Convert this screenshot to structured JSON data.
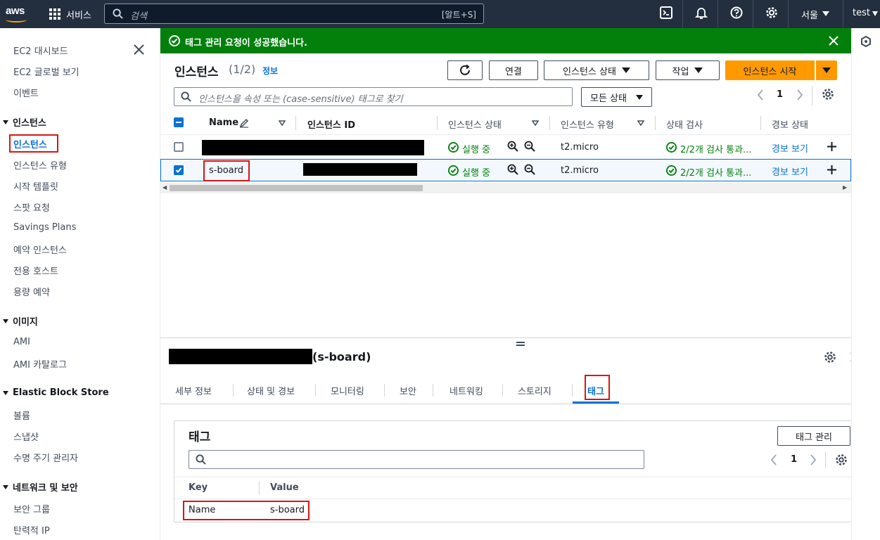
{
  "topbar": {
    "logo_text": "aws",
    "services_label": "서비스",
    "search_placeholder": "검색",
    "search_shortcut": "[알트+S]",
    "region": "서울",
    "user": "test"
  },
  "sidebar": {
    "items": [
      {
        "label": "EC2 대시보드"
      },
      {
        "label": "EC2 글로벌 보기"
      },
      {
        "label": "이벤트"
      }
    ],
    "sections": [
      {
        "title": "인스턴스",
        "items": [
          "인스턴스",
          "인스턴스 유형",
          "시작 템플릿",
          "스팟 요청",
          "Savings Plans",
          "예약 인스턴스",
          "전용 호스트",
          "용량 예약"
        ]
      },
      {
        "title": "이미지",
        "items": [
          "AMI",
          "AMI 카탈로그"
        ]
      },
      {
        "title": "Elastic Block Store",
        "items": [
          "볼륨",
          "스냅샷",
          "수명 주기 관리자"
        ]
      },
      {
        "title": "네트워크 및 보안",
        "items": [
          "보안 그룹",
          "탄력적 IP"
        ]
      }
    ]
  },
  "flash": {
    "message": "태그 관리 요청이 성공했습니다."
  },
  "instances": {
    "title": "인스턴스",
    "count": "(1/2)",
    "info_link": "정보",
    "buttons": {
      "connect": "연결",
      "state": "인스턴스 상태",
      "actions": "작업",
      "launch": "인스턴스 시작"
    },
    "search_placeholder": "인스턴스을 속성 또는 (case-sensitive) 태그로 찾기",
    "filter": "모든 상태",
    "page": "1",
    "columns": [
      "Name",
      "인스턴스 ID",
      "인스턴스 상태",
      "인스턴스 유형",
      "상태 검사",
      "경보 상태"
    ],
    "rows": [
      {
        "name": "",
        "state": "실행 중",
        "type": "t2.micro",
        "check": "2/2개 검사 통과...",
        "alarm": "경보 보기"
      },
      {
        "name": "s-board",
        "state": "실행 중",
        "type": "t2.micro",
        "check": "2/2개 검사 통과...",
        "alarm": "경보 보기"
      }
    ]
  },
  "detail": {
    "title_suffix": "(s-board)",
    "tabs": [
      "세부 정보",
      "상태 및 경보",
      "모니터링",
      "보안",
      "네트워킹",
      "스토리지",
      "태그"
    ],
    "tags_panel": {
      "title": "태그",
      "manage_button": "태그 관리",
      "page": "1",
      "columns": [
        "Key",
        "Value"
      ],
      "rows": [
        {
          "key": "Name",
          "value": "s-board"
        }
      ]
    }
  },
  "colors": {
    "topbar": "#232f3e",
    "success": "#037f0c",
    "primary": "#ff9900",
    "link": "#0972d3",
    "highlight": "#d91515"
  }
}
